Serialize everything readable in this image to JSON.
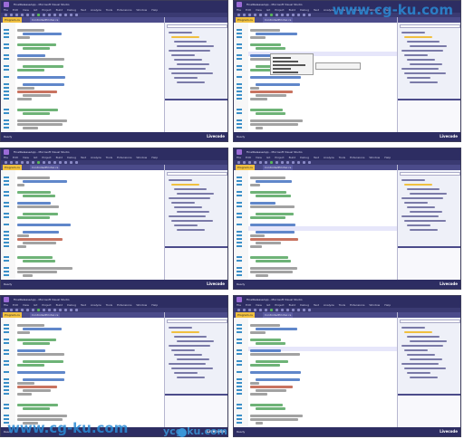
{
  "watermark": {
    "text": "www.cg-ku.com",
    "center_text": "ycg-ku.com"
  },
  "window": {
    "title": "FinalReleaseApp - Microsoft Visual Studio",
    "menu": [
      "File",
      "Edit",
      "View",
      "Git",
      "Project",
      "Build",
      "Debug",
      "Test",
      "Analyze",
      "Tools",
      "Extensions",
      "Window",
      "Help"
    ],
    "tab_active": "Program.cs",
    "tab_inactive": "ControlledPrinter.cs",
    "status_label": "Ready",
    "status_right": "Livecode"
  },
  "colors": {
    "titlebar": "#2d2d62",
    "accent_tab": "#f0c040",
    "keyword": "#2b5fb8",
    "comment": "#3e9a4a",
    "string": "#b5442b",
    "plain": "#555555",
    "watermark": "#2a8ad4"
  },
  "icons": [
    "visual-studio-logo-icon",
    "solution-explorer-icon",
    "toolbar-run-icon"
  ]
}
